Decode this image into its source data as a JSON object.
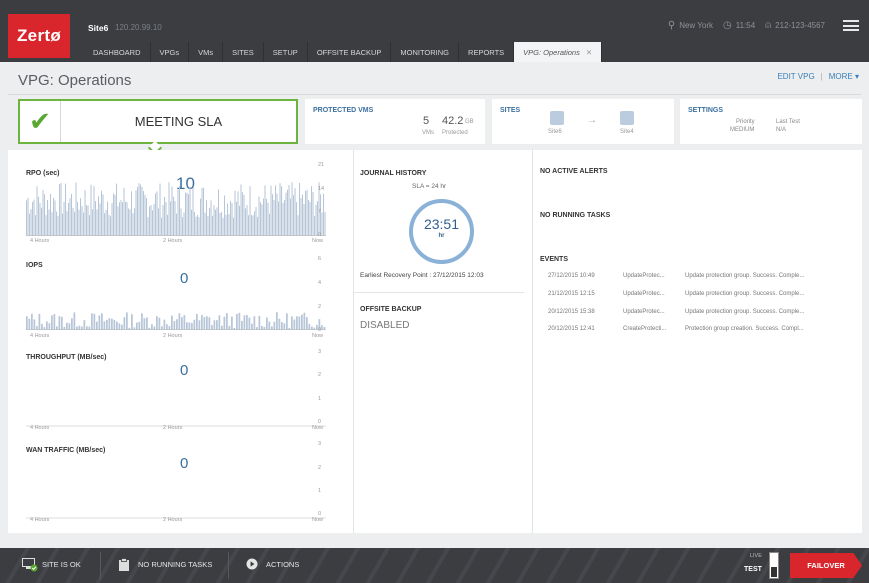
{
  "brand": {
    "logo": "Zertø"
  },
  "site": {
    "name": "Site6",
    "ip": "120.20.99.10"
  },
  "header": {
    "location": "New York",
    "time": "11:54",
    "phone": "212-123-4567"
  },
  "nav": [
    {
      "label": "DASHBOARD",
      "w": 0
    },
    {
      "label": "VPGs"
    },
    {
      "label": "VMs"
    },
    {
      "label": "SITES"
    },
    {
      "label": "SETUP"
    },
    {
      "label": "OFFSITE BACKUP"
    },
    {
      "label": "MONITORING"
    },
    {
      "label": "REPORTS"
    },
    {
      "label": "VPG: Operations",
      "active": true
    }
  ],
  "page": {
    "title": "VPG: Operations",
    "edit": "EDIT VPG",
    "more": "MORE"
  },
  "sla": {
    "status": "MEETING SLA"
  },
  "protected_vms": {
    "title": "PROTECTED VMs",
    "vms_count": "5",
    "vms_unit": "VMs",
    "size": "42.2",
    "size_unit": "GB",
    "size_label": "Protected"
  },
  "sites": {
    "title": "SITES",
    "source": "Site6",
    "target": "Site4"
  },
  "settings": {
    "title": "SETTINGS",
    "priority_label": "Priority",
    "priority_value": "MEDIUM",
    "last_test_label": "Last Test",
    "last_test_value": "N/A"
  },
  "charts": {
    "rpo": {
      "title": "RPO (sec)",
      "value": "10",
      "x_left": "4 Hours",
      "x_mid": "2 Hours",
      "x_right": "Now",
      "y": [
        "21",
        "14",
        "7",
        "0"
      ]
    },
    "iops": {
      "title": "IOPS",
      "value": "0",
      "x_left": "4 Hours",
      "x_mid": "2 Hours",
      "x_right": "Now",
      "y": [
        "6",
        "4",
        "2",
        "0"
      ]
    },
    "throughput": {
      "title": "THROUGHPUT (MB/sec)",
      "value": "0",
      "x_left": "4 Hours",
      "x_mid": "2 Hours",
      "x_right": "Now",
      "y": [
        "3",
        "2",
        "1",
        "0"
      ]
    },
    "wan": {
      "title": "WAN TRAFFIC (MB/sec)",
      "value": "0",
      "x_left": "4 Hours",
      "x_mid": "2 Hours",
      "x_right": "Now",
      "y": [
        "3",
        "2",
        "1",
        "0"
      ]
    }
  },
  "journal": {
    "title": "JOURNAL HISTORY",
    "sla": "SLA = 24 hr",
    "value": "23:51",
    "unit": "hr",
    "earliest": "Earliest Recovery Point : 27/12/2015 12:03"
  },
  "offsite": {
    "title": "OFFSITE BACKUP",
    "status": "DISABLED"
  },
  "alerts": {
    "title": "NO ACTIVE ALERTS"
  },
  "tasks": {
    "title": "NO RUNNING TASKS"
  },
  "events": {
    "title": "EVENTS",
    "rows": [
      {
        "time": "27/12/2015 10:49",
        "type": "UpdateProtec...",
        "desc": "Update protection group. Success. Comple..."
      },
      {
        "time": "21/12/2015 12:15",
        "type": "UpdateProtec...",
        "desc": "Update protection group. Success. Comple..."
      },
      {
        "time": "20/12/2015 15:38",
        "type": "UpdateProtec...",
        "desc": "Update protection group. Success. Comple..."
      },
      {
        "time": "20/12/2015 12:41",
        "type": "CreateProtecti...",
        "desc": "Protection group creation. Success. Compl..."
      }
    ]
  },
  "bottom": {
    "site_status": "SITE IS OK",
    "tasks": "NO RUNNING TASKS",
    "actions": "ACTIONS",
    "live": "LIVE",
    "test": "TEST",
    "failover": "FAILOVER"
  },
  "colors": {
    "brand_red": "#d8262c",
    "sla_green": "#6db33f",
    "accent_blue": "#3a6fa0",
    "chart_fill": "#b7c6d8"
  }
}
